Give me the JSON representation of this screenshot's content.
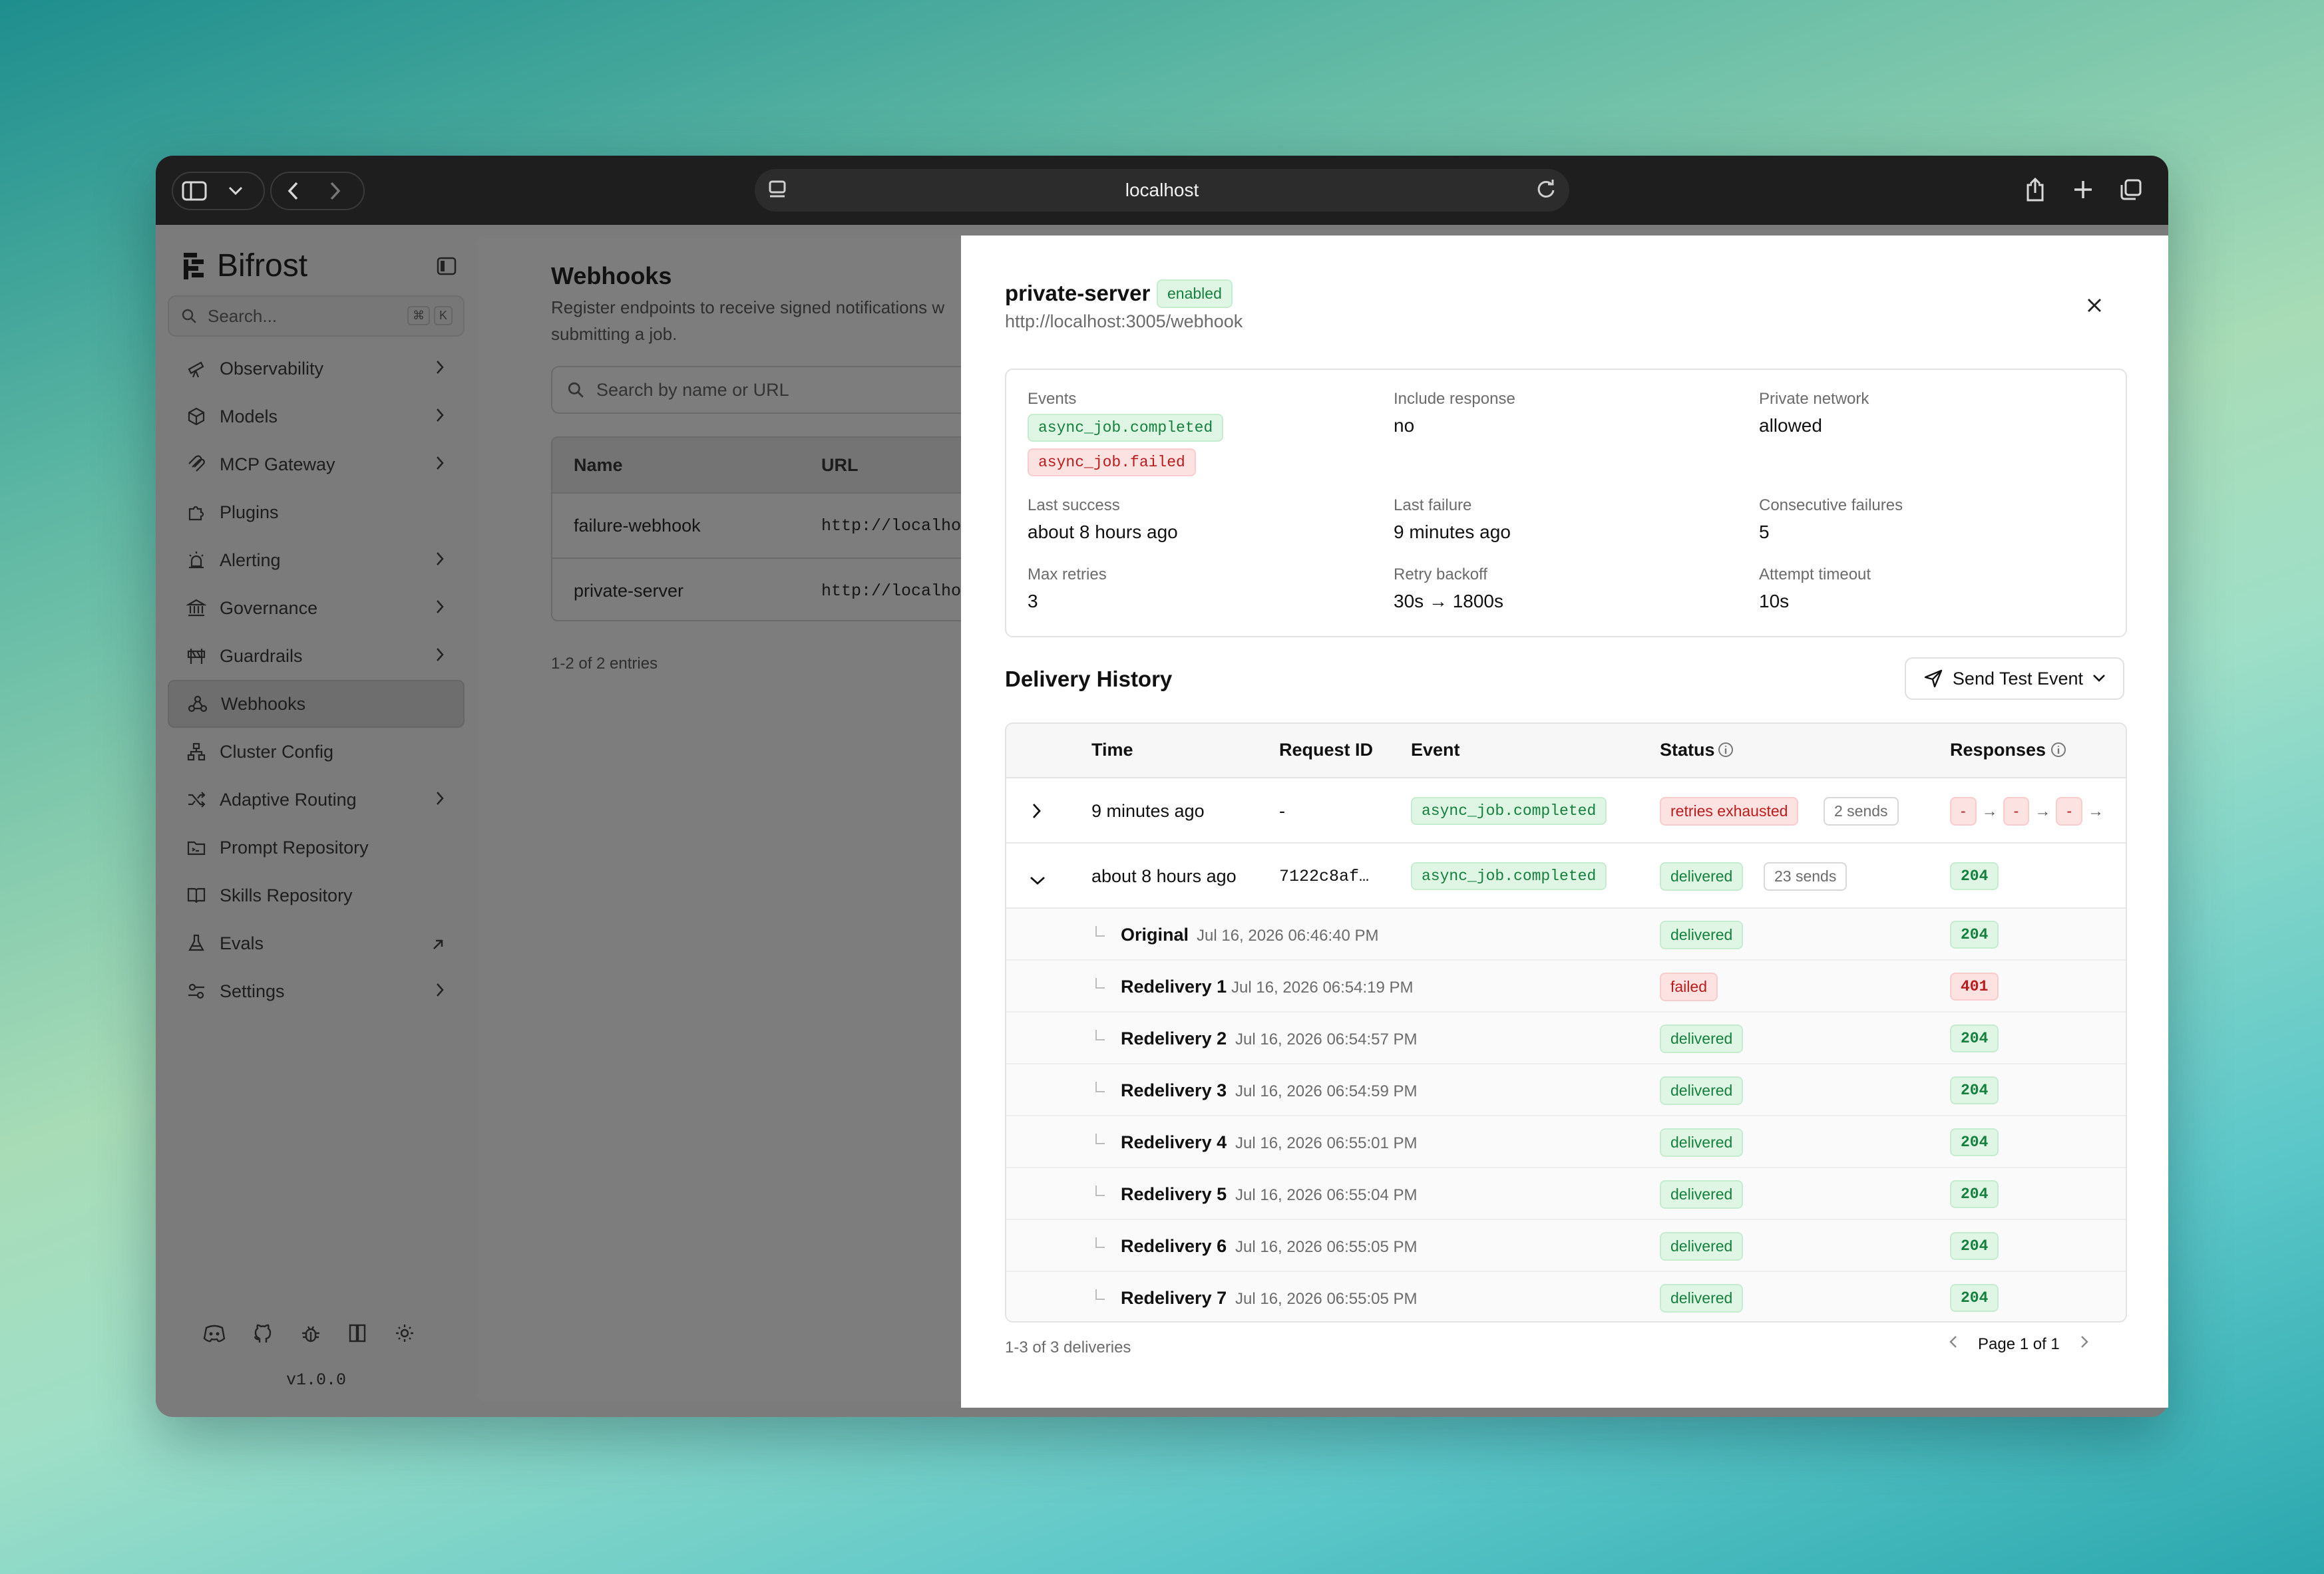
{
  "browser": {
    "url": "localhost"
  },
  "sidebar": {
    "brand": "Bifrost",
    "search_placeholder": "Search...",
    "kbd": [
      "⌘",
      "K"
    ],
    "items": [
      {
        "label": "Observability",
        "has_chevron": true
      },
      {
        "label": "Models",
        "has_chevron": true
      },
      {
        "label": "MCP Gateway",
        "has_chevron": true
      },
      {
        "label": "Plugins",
        "has_chevron": false
      },
      {
        "label": "Alerting",
        "has_chevron": true
      },
      {
        "label": "Governance",
        "has_chevron": true
      },
      {
        "label": "Guardrails",
        "has_chevron": true
      },
      {
        "label": "Webhooks",
        "has_chevron": false,
        "active": true
      },
      {
        "label": "Cluster Config",
        "has_chevron": false
      },
      {
        "label": "Adaptive Routing",
        "has_chevron": true
      },
      {
        "label": "Prompt Repository",
        "has_chevron": false
      },
      {
        "label": "Skills Repository",
        "has_chevron": false
      },
      {
        "label": "Evals",
        "external": true
      },
      {
        "label": "Settings",
        "has_chevron": true
      }
    ],
    "footer_icons": [
      "discord-icon",
      "github-icon",
      "bug-icon",
      "docs-icon",
      "theme-icon"
    ],
    "version": "v1.0.0"
  },
  "page": {
    "title": "Webhooks",
    "desc_line1": "Register endpoints to receive signed notifications w",
    "desc_line2": "submitting a job.",
    "search_placeholder": "Search by name or URL",
    "columns": [
      "Name",
      "URL"
    ],
    "rows": [
      {
        "name": "failure-webhook",
        "url": "http://localhos"
      },
      {
        "name": "private-server",
        "url": "http://localhos"
      }
    ],
    "count": "1-2 of 2 entries"
  },
  "drawer": {
    "title": "private-server",
    "status": "enabled",
    "url": "http://localhost:3005/webhook",
    "info": {
      "events_label": "Events",
      "events": [
        {
          "name": "async_job.completed",
          "tone": "green"
        },
        {
          "name": "async_job.failed",
          "tone": "red"
        }
      ],
      "include_response_label": "Include response",
      "include_response": "no",
      "private_network_label": "Private network",
      "private_network": "allowed",
      "last_success_label": "Last success",
      "last_success": "about 8 hours ago",
      "last_failure_label": "Last failure",
      "last_failure": "9 minutes ago",
      "consecutive_failures_label": "Consecutive failures",
      "consecutive_failures": "5",
      "max_retries_label": "Max retries",
      "max_retries": "3",
      "retry_backoff_label": "Retry backoff",
      "retry_backoff": "30s → 1800s",
      "attempt_timeout_label": "Attempt timeout",
      "attempt_timeout": "10s"
    },
    "history_title": "Delivery History",
    "send_test_label": "Send Test Event",
    "columns": {
      "time": "Time",
      "request_id": "Request ID",
      "event": "Event",
      "status": "Status",
      "responses": "Responses"
    },
    "rows": [
      {
        "time": "9 minutes ago",
        "request_id": "-",
        "event": "async_job.completed",
        "status": "retries exhausted",
        "sends": "2 sends",
        "responses": [
          "-",
          "-",
          "-"
        ]
      },
      {
        "time": "about 8 hours ago",
        "request_id": "7122c8af…",
        "event": "async_job.completed",
        "status": "delivered",
        "sends": "23 sends",
        "responses": [
          "204"
        ]
      }
    ],
    "sub_rows": [
      {
        "label": "Original",
        "time": "Jul 16, 2026 06:46:40 PM",
        "status": "delivered",
        "code": "204"
      },
      {
        "label": "Redelivery 1",
        "time": "Jul 16, 2026 06:54:19 PM",
        "status": "failed",
        "code": "401"
      },
      {
        "label": "Redelivery 2",
        "time": "Jul 16, 2026 06:54:57 PM",
        "status": "delivered",
        "code": "204"
      },
      {
        "label": "Redelivery 3",
        "time": "Jul 16, 2026 06:54:59 PM",
        "status": "delivered",
        "code": "204"
      },
      {
        "label": "Redelivery 4",
        "time": "Jul 16, 2026 06:55:01 PM",
        "status": "delivered",
        "code": "204"
      },
      {
        "label": "Redelivery 5",
        "time": "Jul 16, 2026 06:55:04 PM",
        "status": "delivered",
        "code": "204"
      },
      {
        "label": "Redelivery 6",
        "time": "Jul 16, 2026 06:55:05 PM",
        "status": "delivered",
        "code": "204"
      },
      {
        "label": "Redelivery 7",
        "time": "Jul 16, 2026 06:55:05 PM",
        "status": "delivered",
        "code": "204"
      }
    ],
    "footer_count": "1-3 of 3 deliveries",
    "pagination": "Page 1 of 1"
  }
}
